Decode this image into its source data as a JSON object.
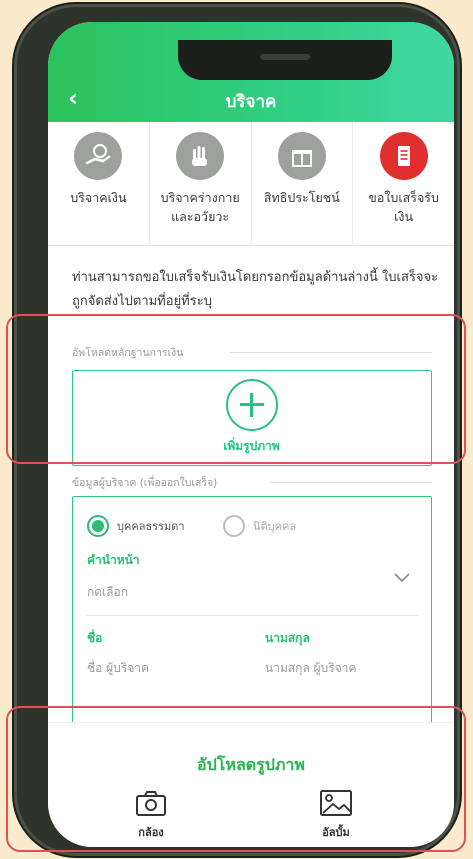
{
  "header": {
    "back_icon": "chevron-left-icon",
    "title": "บริจาค"
  },
  "menu": [
    {
      "label": "บริจาคเงิน",
      "icon": "hand-coin-icon",
      "active": false
    },
    {
      "label": "บริจาคร่างกาย และอวัยวะ",
      "icon": "raised-hand-icon",
      "active": false
    },
    {
      "label": "สิทธิประโยชน์",
      "icon": "gift-icon",
      "active": false
    },
    {
      "label": "ขอใบเสร็จรับ เงิน",
      "icon": "receipt-icon",
      "active": true
    }
  ],
  "intro_text": "ท่านสามารถขอใบเสร็จรับเงินโดยกรอกข้อมูลด้านล่างนี้ ใบเสร็จจะถูกจัดส่งไปตามที่อยู่ที่ระบุ",
  "evidence_section": {
    "title": "อัพโหลดหลักฐานการเงิน",
    "add_label": "เพิ่มรูปภาพ"
  },
  "donor_section": {
    "title": "ข้อมูลผู้บริจาค (เพื่อออกใบเสร็จ)",
    "radio_person": "บุคคลธรรมดา",
    "radio_entity": "นิติบุคคล",
    "prefix_label": "คำนำหน้า",
    "prefix_value": "กดเลือก",
    "first_name_label": "ชื่อ",
    "first_name_placeholder": "ชื่อ ผู้บริจาค",
    "last_name_label": "นามสกุล",
    "last_name_placeholder": "นามสกุล ผู้บริจาค"
  },
  "upload_sheet": {
    "title": "อัปโหลดรูปภาพ",
    "camera_label": "กล้อง",
    "album_label": "อัลบั้ม"
  },
  "colors": {
    "brand_green": "#2cc35d",
    "accent_teal": "#27c283",
    "highlight_red": "#e05151",
    "receipt_red": "#e02f2f"
  }
}
